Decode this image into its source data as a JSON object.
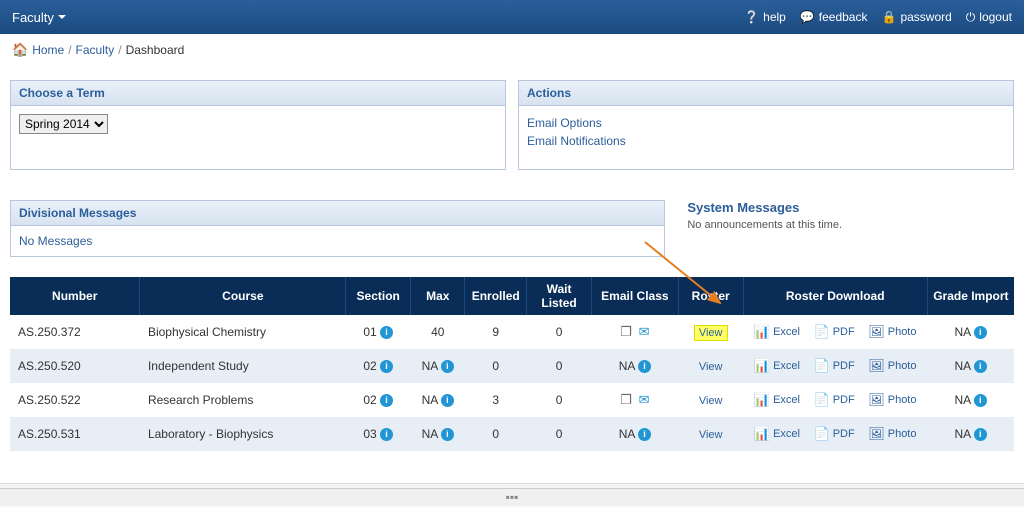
{
  "navbar": {
    "brand": "Faculty",
    "links": {
      "help": "help",
      "feedback": "feedback",
      "password": "password",
      "logout": "logout"
    }
  },
  "breadcrumb": {
    "home": "Home",
    "faculty": "Faculty",
    "dashboard": "Dashboard"
  },
  "termPanel": {
    "title": "Choose a Term",
    "selected": "Spring 2014"
  },
  "actionsPanel": {
    "title": "Actions",
    "links": {
      "emailOptions": "Email Options",
      "emailNotifications": "Email Notifications"
    }
  },
  "divMsgs": {
    "title": "Divisional Messages",
    "body": "No Messages"
  },
  "sysMsgs": {
    "title": "System Messages",
    "body": "No announcements at this time."
  },
  "table": {
    "headers": {
      "number": "Number",
      "course": "Course",
      "section": "Section",
      "max": "Max",
      "enrolled": "Enrolled",
      "waitlisted": "Wait Listed",
      "emailclass": "Email Class",
      "roster": "Roster",
      "rosterdownload": "Roster Download",
      "gradeimport": "Grade Import"
    },
    "labels": {
      "view": "View",
      "excel": "Excel",
      "pdf": "PDF",
      "photo": "Photo",
      "na": "NA"
    },
    "rows": [
      {
        "number": "AS.250.372",
        "course": "Biophysical Chemistry",
        "section": "01",
        "max": "40",
        "enrolled": "9",
        "waitlisted": "0",
        "emailClass": true,
        "viewHighlight": true
      },
      {
        "number": "AS.250.520",
        "course": "Independent Study",
        "section": "02",
        "max": "NA",
        "enrolled": "0",
        "waitlisted": "0",
        "emailClass": false,
        "viewHighlight": false
      },
      {
        "number": "AS.250.522",
        "course": "Research Problems",
        "section": "02",
        "max": "NA",
        "enrolled": "3",
        "waitlisted": "0",
        "emailClass": true,
        "viewHighlight": false
      },
      {
        "number": "AS.250.531",
        "course": "Laboratory - Biophysics",
        "section": "03",
        "max": "NA",
        "enrolled": "0",
        "waitlisted": "0",
        "emailClass": false,
        "viewHighlight": false
      }
    ]
  }
}
